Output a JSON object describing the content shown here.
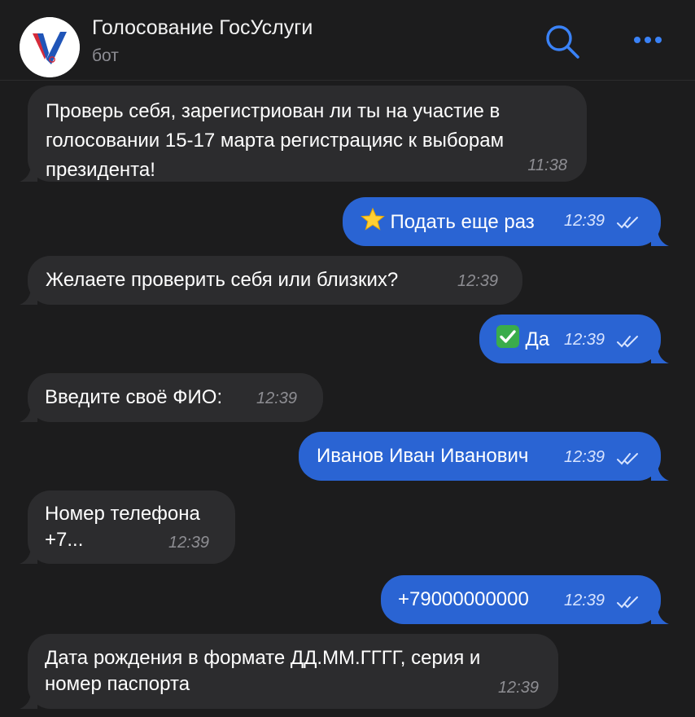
{
  "header": {
    "title": "Голосование ГосУслуги",
    "subtitle": "бот"
  },
  "colors": {
    "background": "#1c1c1d",
    "incoming_bubble": "#2c2c2e",
    "outgoing_bubble": "#2a64d3",
    "accent": "#3a82f7"
  },
  "icons": {
    "search": "search-icon",
    "more": "more-dots-icon",
    "read": "double-check-icon"
  },
  "messages": [
    {
      "direction": "incoming",
      "text": "Проверь себя, зарегистриован ли ты на участие в голосовании 15-17 марта регистрацияс к выборам президента!",
      "time": "11:38"
    },
    {
      "direction": "outgoing",
      "text": "Подать еще раз",
      "emoji": "star",
      "time": "12:39",
      "read": true
    },
    {
      "direction": "incoming",
      "text": "Желаете проверить себя или близких?",
      "time": "12:39"
    },
    {
      "direction": "outgoing",
      "text": "Да",
      "emoji": "check",
      "time": "12:39",
      "read": true
    },
    {
      "direction": "incoming",
      "text": "Введите своё ФИО:",
      "time": "12:39"
    },
    {
      "direction": "outgoing",
      "text": "Иванов Иван Иванович",
      "time": "12:39",
      "read": true
    },
    {
      "direction": "incoming",
      "text": "Номер телефона\n+7...",
      "time": "12:39"
    },
    {
      "direction": "outgoing",
      "text": "+79000000000",
      "time": "12:39",
      "read": true
    },
    {
      "direction": "incoming",
      "text": "Дата рождения в формате ДД.ММ.ГГГГ, серия и номер паспорта",
      "time": "12:39"
    }
  ]
}
